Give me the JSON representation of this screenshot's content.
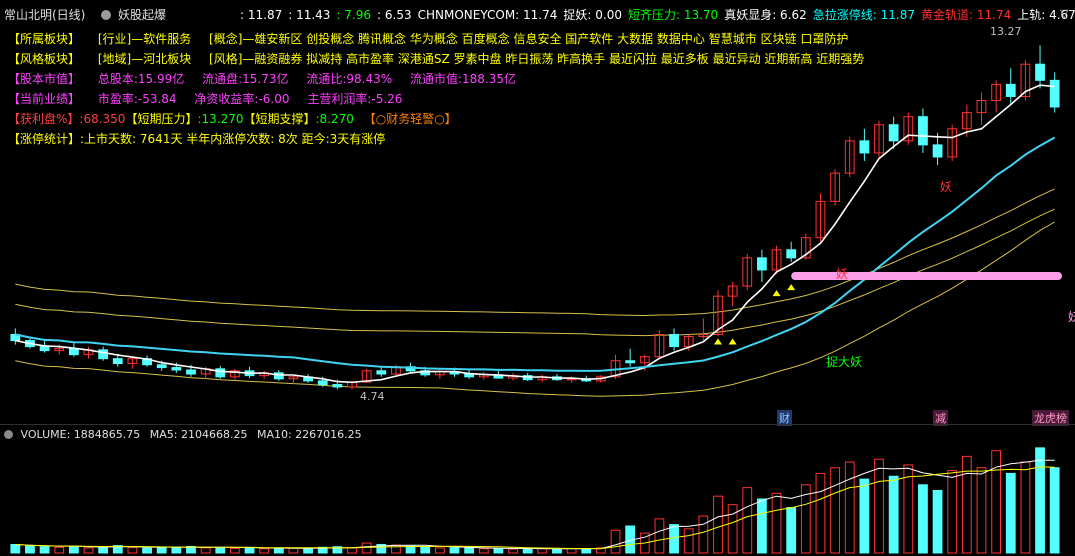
{
  "header": {
    "stock_name": "常山北明(日线)",
    "indicator_name": "妖股起爆",
    "indicator_values": [
      {
        "text": ": 11.87",
        "color": "#ffffff"
      },
      {
        "text": ": 11.43",
        "color": "#ffffff"
      },
      {
        "text": ": 7.96",
        "color": "#00ff00"
      },
      {
        "text": ": 6.53",
        "color": "#ffffff"
      },
      {
        "text": "CHNMONEYCOM: 11.74",
        "color": "#ffffff"
      },
      {
        "text": "捉妖: 0.00",
        "color": "#ffffff"
      },
      {
        "text": "短齐压力: 13.70",
        "color": "#00ff00"
      },
      {
        "text": "真妖显身: 6.62",
        "color": "#ffffff"
      },
      {
        "text": "急拉涨停线: 11.87",
        "color": "#00ffff"
      },
      {
        "text": "黄金轨道: 11.74",
        "color": "#ff3030"
      },
      {
        "text": "上轨: 4.67",
        "color": "#ffffff"
      }
    ]
  },
  "info": {
    "row1": {
      "label": "【所属板块】",
      "a": "[行业]—软件服务",
      "b": "[概念]—雄安新区 创投概念 腾讯概念 华为概念 百度概念 信息安全 国产软件 大数据 数据中心 智慧城市 区块链 口罩防护"
    },
    "row2": {
      "label": "【风格板块】",
      "a": "[地域]—河北板块",
      "b": "[风格]—融资融券 拟减持 高市盈率 深港通SZ 罗素中盘 昨日振荡 昨高换手 最近闪拉 最近多板 最近异动 近期新高 近期强势"
    },
    "row3": {
      "label": "【股本市值】",
      "a": "总股本:15.99亿",
      "b": "流通盘:15.73亿",
      "c": "流通比:98.43%",
      "d": "流通市值:188.35亿"
    },
    "row4": {
      "label": "【当前业绩】",
      "a": "市盈率:-53.84",
      "b": "净资收益率:-6.00",
      "c": "主营利润率:-5.26"
    },
    "row5": {
      "label": "【获利盘%】",
      "a": ":68.350",
      "b": "【短期压力】",
      "c": ":13.270",
      "d": "【短期支撑】",
      "e": ":8.270",
      "f": "【○财务轻警○】"
    },
    "row6": {
      "label": "【涨停统计】",
      "a": ":上市天数: 7641天  半年内涨停次数: 8次    距今:3天有涨停"
    }
  },
  "annotations": {
    "high_label": "13.27",
    "low_label": "4.74",
    "signal_text": "捉大妖",
    "tag1": "妖",
    "tag2": "妖",
    "event_cai": "财",
    "event_jian": "减",
    "event_lhb": "龙虎榜"
  },
  "volume": {
    "label": "VOLUME: 1884865.75",
    "ma5": "MA5: 2104668.25",
    "ma10": "MA10: 2267016.25"
  },
  "colors": {
    "up": "#ff3232",
    "down": "#54ffff",
    "ma_white": "#ffffff",
    "ma_cyan": "#3fd4f2",
    "band_yellow": "#d6c048",
    "pink_bar": "#ff9ee8"
  },
  "chart_data": {
    "type": "candlestick",
    "price_range": [
      4.74,
      13.27
    ],
    "candles": [
      [
        6.1,
        6.25,
        5.85,
        5.95
      ],
      [
        5.95,
        6.05,
        5.75,
        5.8
      ],
      [
        5.8,
        5.95,
        5.65,
        5.7
      ],
      [
        5.7,
        5.85,
        5.6,
        5.75
      ],
      [
        5.75,
        5.9,
        5.55,
        5.6
      ],
      [
        5.6,
        5.8,
        5.5,
        5.72
      ],
      [
        5.72,
        5.8,
        5.45,
        5.5
      ],
      [
        5.5,
        5.62,
        5.3,
        5.38
      ],
      [
        5.38,
        5.55,
        5.25,
        5.5
      ],
      [
        5.5,
        5.58,
        5.3,
        5.35
      ],
      [
        5.35,
        5.45,
        5.2,
        5.28
      ],
      [
        5.28,
        5.4,
        5.15,
        5.22
      ],
      [
        5.22,
        5.35,
        5.05,
        5.12
      ],
      [
        5.12,
        5.3,
        5.0,
        5.25
      ],
      [
        5.25,
        5.32,
        5.0,
        5.05
      ],
      [
        5.05,
        5.25,
        4.98,
        5.2
      ],
      [
        5.2,
        5.3,
        5.02,
        5.08
      ],
      [
        5.08,
        5.2,
        5.0,
        5.15
      ],
      [
        5.15,
        5.22,
        4.95,
        5.0
      ],
      [
        5.0,
        5.1,
        4.88,
        5.05
      ],
      [
        5.05,
        5.12,
        4.9,
        4.95
      ],
      [
        4.95,
        5.05,
        4.8,
        4.86
      ],
      [
        4.86,
        4.98,
        4.74,
        4.8
      ],
      [
        4.8,
        4.95,
        4.74,
        4.92
      ],
      [
        4.92,
        5.25,
        4.9,
        5.2
      ],
      [
        5.2,
        5.3,
        5.05,
        5.12
      ],
      [
        5.12,
        5.35,
        5.1,
        5.3
      ],
      [
        5.3,
        5.4,
        5.15,
        5.2
      ],
      [
        5.2,
        5.3,
        5.05,
        5.1
      ],
      [
        5.1,
        5.25,
        5.0,
        5.18
      ],
      [
        5.18,
        5.28,
        5.05,
        5.12
      ],
      [
        5.12,
        5.22,
        5.0,
        5.05
      ],
      [
        5.05,
        5.18,
        4.98,
        5.1
      ],
      [
        5.1,
        5.2,
        5.0,
        5.02
      ],
      [
        5.02,
        5.15,
        4.96,
        5.08
      ],
      [
        5.08,
        5.15,
        4.95,
        4.98
      ],
      [
        4.98,
        5.1,
        4.92,
        5.05
      ],
      [
        5.05,
        5.12,
        4.95,
        4.98
      ],
      [
        4.98,
        5.05,
        4.9,
        5.0
      ],
      [
        5.0,
        5.08,
        4.92,
        4.95
      ],
      [
        4.95,
        5.1,
        4.9,
        5.05
      ],
      [
        5.05,
        5.6,
        5.0,
        5.45
      ],
      [
        5.45,
        5.75,
        5.3,
        5.4
      ],
      [
        5.4,
        5.6,
        5.2,
        5.55
      ],
      [
        5.55,
        6.2,
        5.5,
        6.1
      ],
      [
        6.1,
        6.25,
        5.7,
        5.8
      ],
      [
        5.8,
        6.1,
        5.7,
        6.05
      ],
      [
        6.05,
        6.5,
        5.95,
        6.1
      ],
      [
        6.1,
        7.2,
        6.05,
        7.05
      ],
      [
        7.05,
        7.4,
        6.8,
        7.3
      ],
      [
        7.3,
        8.1,
        7.2,
        8.0
      ],
      [
        8.0,
        8.2,
        7.4,
        7.7
      ],
      [
        7.7,
        8.3,
        7.6,
        8.2
      ],
      [
        8.2,
        8.4,
        7.9,
        8.0
      ],
      [
        8.0,
        8.6,
        7.95,
        8.5
      ],
      [
        8.5,
        9.6,
        8.4,
        9.4
      ],
      [
        9.4,
        10.2,
        9.3,
        10.1
      ],
      [
        10.1,
        11.0,
        10.0,
        10.9
      ],
      [
        10.9,
        11.2,
        10.4,
        10.6
      ],
      [
        10.6,
        11.4,
        10.5,
        11.3
      ],
      [
        11.3,
        11.5,
        10.7,
        10.9
      ],
      [
        10.9,
        11.6,
        10.8,
        11.5
      ],
      [
        11.5,
        11.7,
        10.6,
        10.8
      ],
      [
        10.8,
        11.1,
        10.3,
        10.5
      ],
      [
        10.5,
        11.3,
        10.4,
        11.2
      ],
      [
        11.2,
        11.8,
        11.0,
        11.6
      ],
      [
        11.6,
        12.1,
        11.3,
        11.9
      ],
      [
        11.9,
        12.4,
        11.6,
        12.3
      ],
      [
        12.3,
        12.7,
        11.8,
        12.0
      ],
      [
        12.0,
        12.9,
        11.9,
        12.8
      ],
      [
        12.8,
        13.27,
        12.2,
        12.4
      ],
      [
        12.4,
        12.6,
        11.6,
        11.74
      ]
    ],
    "volumes": [
      0.3,
      0.25,
      0.22,
      0.2,
      0.24,
      0.18,
      0.22,
      0.26,
      0.2,
      0.17,
      0.19,
      0.21,
      0.23,
      0.18,
      0.2,
      0.16,
      0.19,
      0.15,
      0.18,
      0.17,
      0.16,
      0.2,
      0.22,
      0.18,
      0.35,
      0.3,
      0.28,
      0.24,
      0.2,
      0.18,
      0.19,
      0.17,
      0.15,
      0.16,
      0.14,
      0.17,
      0.15,
      0.13,
      0.16,
      0.15,
      0.18,
      0.8,
      0.95,
      0.7,
      1.2,
      1.0,
      0.85,
      1.3,
      2.0,
      1.7,
      2.3,
      1.9,
      2.1,
      1.6,
      2.4,
      2.8,
      3.0,
      3.2,
      2.6,
      3.3,
      2.7,
      3.1,
      2.4,
      2.2,
      2.9,
      3.4,
      3.0,
      3.6,
      2.8,
      3.2,
      3.7,
      3.0
    ],
    "volume_unit": "百万"
  }
}
